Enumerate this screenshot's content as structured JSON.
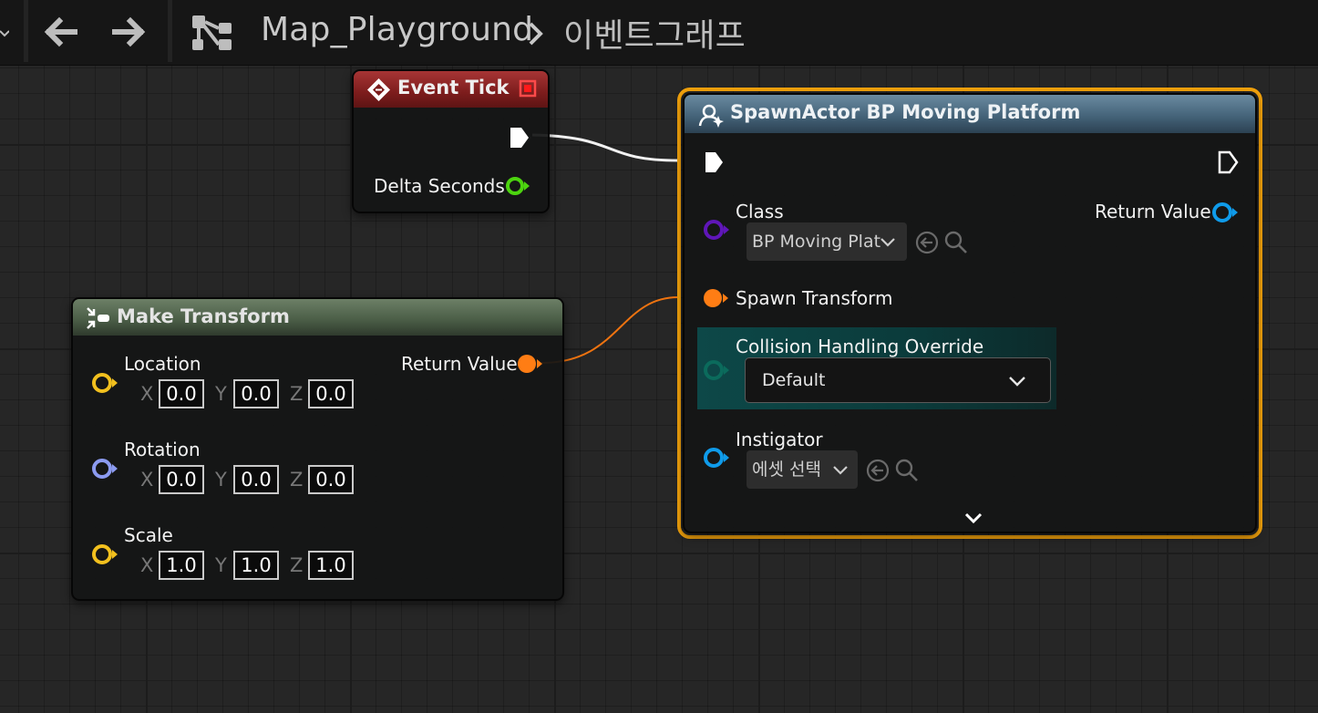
{
  "breadcrumb": {
    "root": "Map_Playground",
    "current": "이벤트그래프"
  },
  "icons": {
    "back": "arrow-left-icon",
    "forward": "arrow-right-icon",
    "graph": "graph-icon",
    "breadcrumb_separator": "chevron-right-icon",
    "event": "event-diamond-icon",
    "function": "function-icon",
    "spawn": "spawn-actor-icon",
    "advanced": "chevron-down-icon"
  },
  "colors": {
    "selection": "#f2a20c",
    "exec_pin": "#ffffff",
    "float_pin": "#4cd40f",
    "class_pin": "#5f16b8",
    "struct_transform_pin": "#ff7d14",
    "vector_pin": "#f2c01e",
    "rotator_pin": "#8c9bf0",
    "object_pin": "#0f9bea",
    "enum_pin": "#0b6b5c"
  },
  "event_tick": {
    "title": "Event Tick",
    "delta_seconds_label": "Delta Seconds"
  },
  "make_transform": {
    "title": "Make Transform",
    "return_label": "Return Value",
    "location": {
      "label": "Location",
      "x": "0.0",
      "y": "0.0",
      "z": "0.0"
    },
    "rotation": {
      "label": "Rotation",
      "x": "0.0",
      "y": "0.0",
      "z": "0.0"
    },
    "scale": {
      "label": "Scale",
      "x": "1.0",
      "y": "1.0",
      "z": "1.0"
    },
    "axis_labels": {
      "x": "X",
      "y": "Y",
      "z": "Z"
    }
  },
  "spawn_actor": {
    "title": "SpawnActor BP Moving Platform",
    "class_label": "Class",
    "class_value": "BP Moving Plat",
    "return_label": "Return Value",
    "spawn_transform_label": "Spawn Transform",
    "collision_label": "Collision Handling Override",
    "collision_value": "Default",
    "instigator_label": "Instigator",
    "instigator_value": "에셋 선택"
  }
}
